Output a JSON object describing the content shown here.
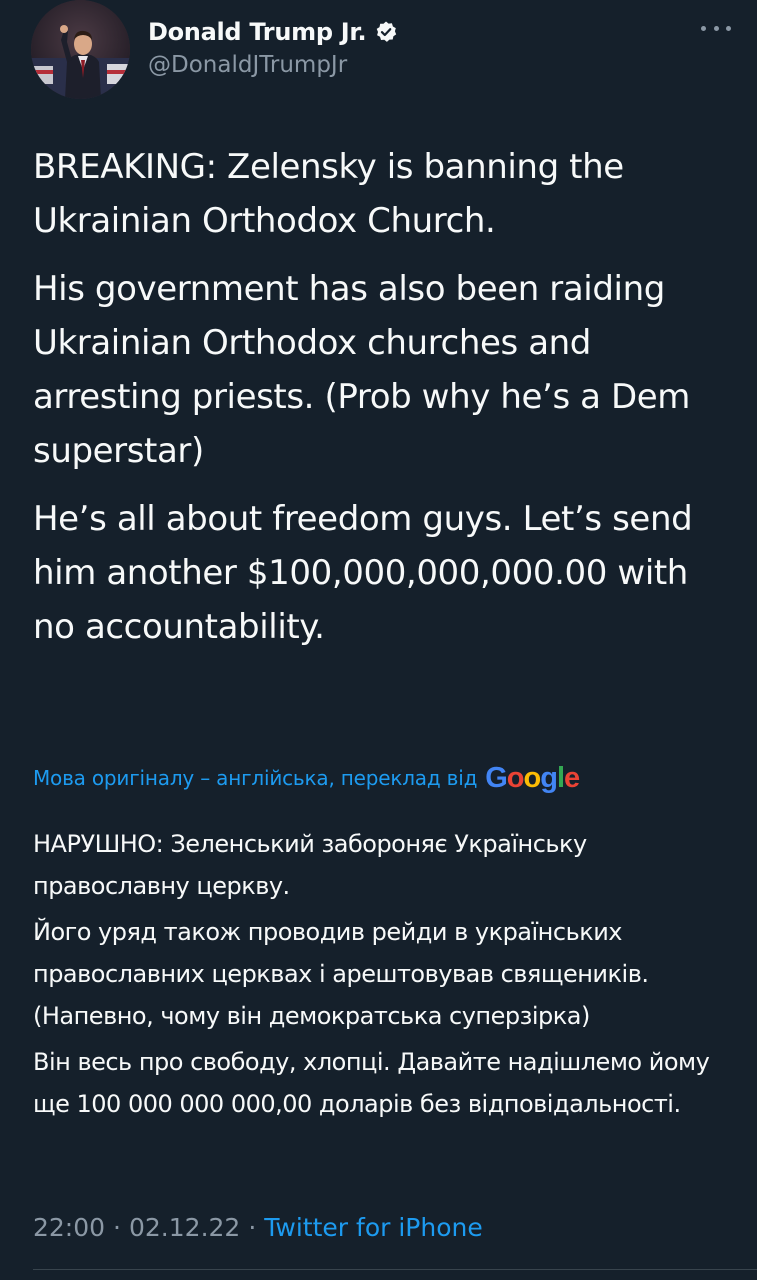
{
  "author": {
    "display_name": "Donald Trump Jr.",
    "handle": "@DonaldJTrumpJr",
    "verified": true
  },
  "tweet": {
    "paragraphs": [
      "BREAKING: Zelensky is banning the Ukrainian Orthodox Church.",
      "His government has also been raiding Ukrainian Orthodox churches and arresting priests. (Prob why he’s a Dem superstar)",
      "He’s all about freedom guys. Let’s send him another $100,000,000,000.00 with no accountability."
    ]
  },
  "translation": {
    "notice": "Мова оригіналу – англійська, переклад від",
    "provider": "Google",
    "paragraphs": [
      "НАРУШНО: Зеленський забороняє Українську православну церкву.",
      "Його уряд також проводив рейди в українських православних церквах і арештовував священиків. (Напевно, чому він демократська суперзірка)",
      "Він весь про свободу, хлопці. Давайте надішлемо йому ще 100 000 000 000,00 доларів без відповідальності."
    ]
  },
  "meta": {
    "time": "22:00",
    "separator": "·",
    "date": "02.12.22",
    "source": "Twitter for iPhone"
  },
  "icons": {
    "verified": "verified-badge-icon",
    "more": "more-horizontal-icon"
  },
  "colors": {
    "background": "#15202b",
    "text": "#f7f9f9",
    "secondary": "#8b98a5",
    "link": "#1d9bf0"
  }
}
